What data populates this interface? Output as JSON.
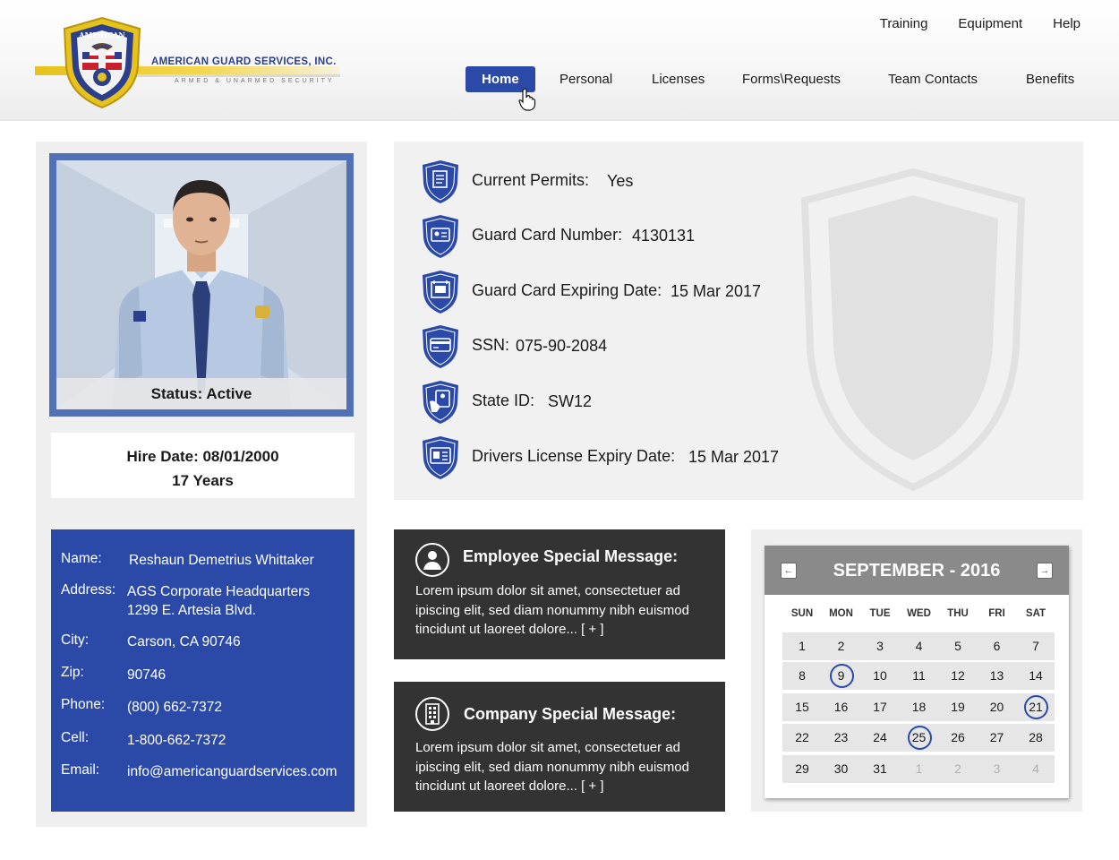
{
  "brand": {
    "company_name": "AMERICAN GUARD SERVICES, INC.",
    "tagline": "ARMED & UNARMED SECURITY",
    "badge_top": "AMERICAN",
    "badge_mid": "GUARD",
    "badge_bottom": "SECURITY",
    "accent_color": "#2b4aa8",
    "gold_color": "#e7c21c"
  },
  "top_nav": [
    "Training",
    "Equipment",
    "Help"
  ],
  "main_nav": {
    "active": "Home",
    "items": [
      "Home",
      "Personal",
      "Licenses",
      "Forms\\Requests",
      "Team Contacts",
      "Benefits"
    ]
  },
  "profile": {
    "status": "Status: Active",
    "hire_date": "Hire Date: 08/01/2000",
    "years": "17 Years"
  },
  "contact": {
    "name_label": "Name:",
    "name": "Reshaun Demetrius Whittaker",
    "address_label": "Address:",
    "address_line1": "AGS Corporate Headquarters",
    "address_line2": "1299 E. Artesia Blvd.",
    "city_label": "City:",
    "city": "Carson, CA 90746",
    "zip_label": "Zip:",
    "zip": "90746",
    "phone_label": "Phone:",
    "phone": "(800) 662-7372",
    "cell_label": "Cell:",
    "cell": "1-800-662-7372",
    "email_label": "Email:",
    "email": "info@americanguardservices.com"
  },
  "info": [
    {
      "label": "Current Permits:",
      "value": "Yes",
      "icon": "scroll-icon"
    },
    {
      "label": "Guard Card Number:",
      "value": "4130131",
      "icon": "id-card-icon"
    },
    {
      "label": "Guard Card Expiring Date:",
      "value": "15 Mar 2017",
      "icon": "calendar-card-icon"
    },
    {
      "label": "SSN:",
      "value": "075-90-2084",
      "icon": "credit-card-icon"
    },
    {
      "label": "State ID:",
      "value": "SW12",
      "icon": "hand-id-icon"
    },
    {
      "label": "Drivers License Expiry Date:",
      "value": "15 Mar 2017",
      "icon": "license-icon"
    }
  ],
  "messages": {
    "employee": {
      "title": "Employee Special Message:",
      "line1": "Lorem ipsum dolor sit amet, consectetuer ad",
      "line2": "ipiscing elit, sed diam nonummy nibh euismod",
      "line3": "tincidunt ut laoreet dolore... [ + ]"
    },
    "company": {
      "title": "Company Special Message:",
      "line1": "Lorem ipsum dolor sit amet, consectetuer ad",
      "line2": "ipiscing elit, sed diam nonummy nibh euismod",
      "line3": "tincidunt ut laoreet dolore... [ + ]"
    }
  },
  "calendar": {
    "title": "SEPTEMBER - 2016",
    "prev": "←",
    "next": "→",
    "weekdays": [
      "SUN",
      "MON",
      "TUE",
      "WED",
      "THU",
      "FRI",
      "SAT"
    ],
    "weeks": [
      [
        "1",
        "2",
        "3",
        "4",
        "5",
        "6",
        "7"
      ],
      [
        "8",
        "9",
        "10",
        "11",
        "12",
        "13",
        "14"
      ],
      [
        "15",
        "16",
        "17",
        "18",
        "19",
        "20",
        "21"
      ],
      [
        "22",
        "23",
        "24",
        "25",
        "26",
        "27",
        "28"
      ],
      [
        "29",
        "30",
        "31",
        "1",
        "2",
        "3",
        "4"
      ]
    ],
    "marked_days": [
      "9",
      "21",
      "25"
    ]
  }
}
